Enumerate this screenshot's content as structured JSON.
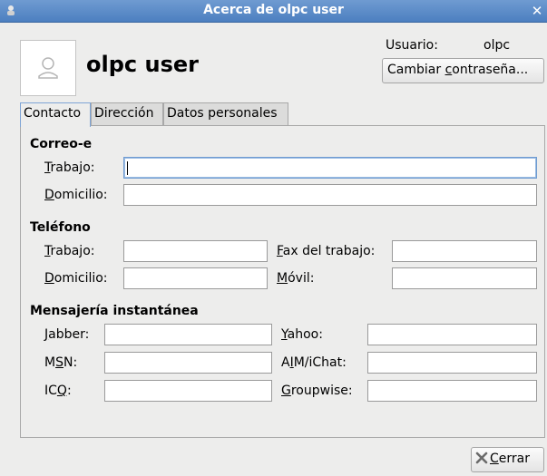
{
  "window": {
    "title": "Acerca de olpc user",
    "close_glyph": "✕"
  },
  "header": {
    "display_name": "olpc user",
    "user_label": "Usuario:",
    "user_value": "olpc",
    "change_password": {
      "mnemonic_pre": "Cambiar ",
      "mnemonic_char": "c",
      "mnemonic_post": "ontraseña..."
    }
  },
  "tabs": [
    {
      "label": "Contacto",
      "active": true
    },
    {
      "label": "Dirección",
      "active": false
    },
    {
      "label": "Datos personales",
      "active": false
    }
  ],
  "contact": {
    "email": {
      "heading": "Correo-e",
      "work": {
        "pre": "",
        "u": "T",
        "post": "rabajo:",
        "value": ""
      },
      "home": {
        "pre": "",
        "u": "D",
        "post": "omicilio:",
        "value": ""
      }
    },
    "phone": {
      "heading": "Teléfono",
      "work": {
        "pre": "",
        "u": "T",
        "post": "rabajo:",
        "value": ""
      },
      "home": {
        "pre": "",
        "u": "D",
        "post": "omicilio:",
        "value": ""
      },
      "fax": {
        "pre": "",
        "u": "F",
        "post": "ax del trabajo:",
        "value": ""
      },
      "mobile": {
        "pre": "",
        "u": "M",
        "post": "óvil:",
        "value": ""
      }
    },
    "im": {
      "heading": "Mensajería instantánea",
      "jabber": {
        "pre": "",
        "u": "J",
        "post": "abber:",
        "value": ""
      },
      "msn": {
        "pre": "M",
        "u": "S",
        "post": "N:",
        "value": ""
      },
      "icq": {
        "pre": "IC",
        "u": "Q",
        "post": ":",
        "value": ""
      },
      "yahoo": {
        "pre": "",
        "u": "Y",
        "post": "ahoo:",
        "value": ""
      },
      "aim": {
        "pre": "A",
        "u": "I",
        "post": "M/iChat:",
        "value": ""
      },
      "groupwise": {
        "pre": "",
        "u": "G",
        "post": "roupwise:",
        "value": ""
      }
    }
  },
  "footer": {
    "close_button": {
      "pre": "",
      "u": "C",
      "post": "errar"
    }
  },
  "icons": {
    "app": "user-info-icon",
    "avatar": "person-silhouette-icon",
    "close": "close-x-icon"
  },
  "colors": {
    "titlebar": "#5b8bc7",
    "focus": "#6f9bd1"
  }
}
